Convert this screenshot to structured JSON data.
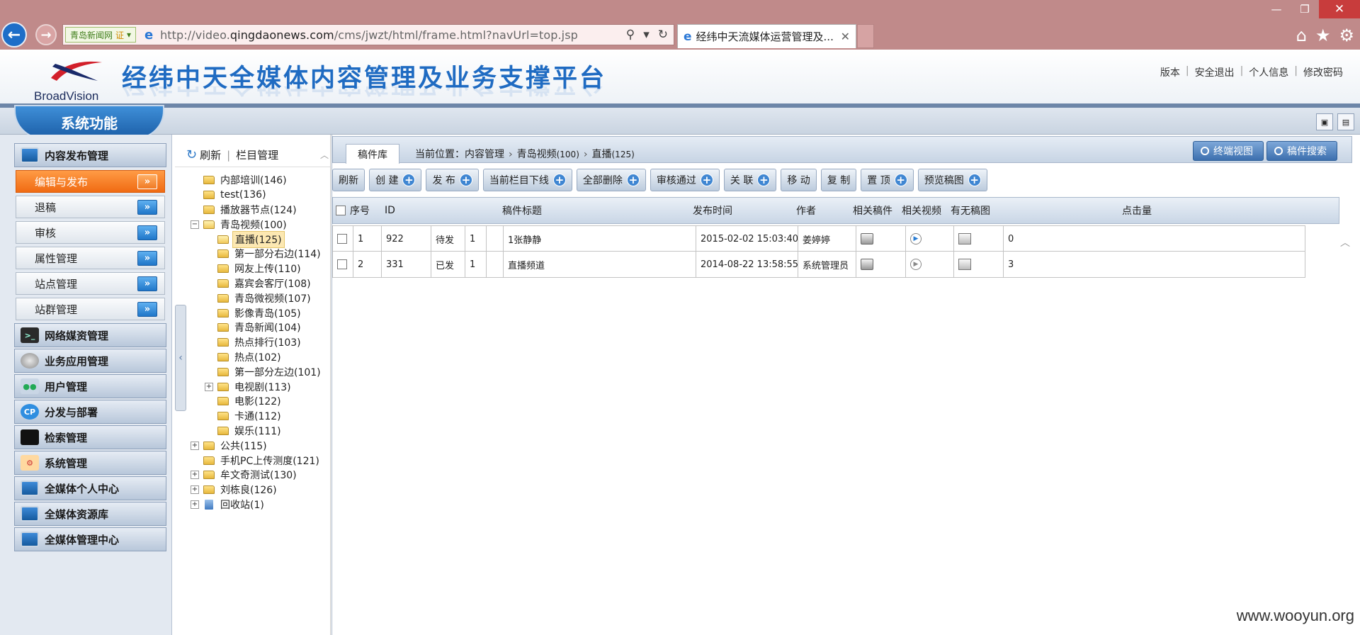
{
  "browser": {
    "site_tag": "青岛新闻网",
    "cert_label": "证",
    "url_prefix": "http://video.",
    "url_domain": "qingdaonews.com",
    "url_path": "/cms/jwzt/html/frame.html?navUrl=top.jsp",
    "tab_title": "经纬中天流媒体运营管理及..."
  },
  "header": {
    "logo_text": "BroadVision",
    "title": "经纬中天全媒体内容管理及业务支撑平台",
    "links": [
      "版本",
      "安全退出",
      "个人信息",
      "修改密码"
    ]
  },
  "function_bar": {
    "label": "系统功能"
  },
  "left_menu": {
    "groups_top": [
      {
        "label": "内容发布管理",
        "icon": "monitor-icon"
      }
    ],
    "sub_items": [
      {
        "label": "编辑与发布",
        "active": true
      },
      {
        "label": "退稿"
      },
      {
        "label": "审核"
      },
      {
        "label": "属性管理"
      },
      {
        "label": "站点管理"
      },
      {
        "label": "站群管理"
      }
    ],
    "groups_bottom": [
      {
        "label": "网络媒资管理",
        "icon": "terminal-icon"
      },
      {
        "label": "业务应用管理",
        "icon": "disk-icon"
      },
      {
        "label": "用户管理",
        "icon": "users-icon"
      },
      {
        "label": "分发与部署",
        "icon": "cp-icon"
      },
      {
        "label": "检索管理",
        "icon": "screen-icon"
      },
      {
        "label": "系统管理",
        "icon": "system-icon"
      },
      {
        "label": "全媒体个人中心",
        "icon": "monitor-icon"
      },
      {
        "label": "全媒体资源库",
        "icon": "monitor-icon"
      },
      {
        "label": "全媒体管理中心",
        "icon": "monitor-icon"
      }
    ]
  },
  "tree": {
    "refresh_label": "刷新",
    "manage_label": "栏目管理",
    "nodes": [
      {
        "label": "内部培训(146)",
        "level": 0,
        "toggle": ""
      },
      {
        "label": "test(136)",
        "level": 0,
        "toggle": ""
      },
      {
        "label": "播放器节点(124)",
        "level": 0,
        "toggle": ""
      },
      {
        "label": "青岛视频(100)",
        "level": 0,
        "toggle": "-",
        "open": true
      },
      {
        "label": "直播(125)",
        "level": 1,
        "toggle": "",
        "selected": true
      },
      {
        "label": "第一部分右边(114)",
        "level": 1,
        "toggle": ""
      },
      {
        "label": "网友上传(110)",
        "level": 1,
        "toggle": ""
      },
      {
        "label": "嘉宾会客厅(108)",
        "level": 1,
        "toggle": ""
      },
      {
        "label": "青岛微视频(107)",
        "level": 1,
        "toggle": ""
      },
      {
        "label": "影像青岛(105)",
        "level": 1,
        "toggle": ""
      },
      {
        "label": "青岛新闻(104)",
        "level": 1,
        "toggle": ""
      },
      {
        "label": "热点排行(103)",
        "level": 1,
        "toggle": ""
      },
      {
        "label": "热点(102)",
        "level": 1,
        "toggle": ""
      },
      {
        "label": "第一部分左边(101)",
        "level": 1,
        "toggle": ""
      },
      {
        "label": "电视剧(113)",
        "level": 1,
        "toggle": "+"
      },
      {
        "label": "电影(122)",
        "level": 1,
        "toggle": ""
      },
      {
        "label": "卡通(112)",
        "level": 1,
        "toggle": ""
      },
      {
        "label": "娱乐(111)",
        "level": 1,
        "toggle": ""
      },
      {
        "label": "公共(115)",
        "level": 0,
        "toggle": "+"
      },
      {
        "label": "手机PC上传测度(121)",
        "level": 0,
        "toggle": ""
      },
      {
        "label": "牟文奇测试(130)",
        "level": 0,
        "toggle": "+"
      },
      {
        "label": "刘栋良(126)",
        "level": 0,
        "toggle": "+"
      },
      {
        "label": "回收站(1)",
        "level": 0,
        "toggle": "+",
        "trash": true
      }
    ]
  },
  "main": {
    "lib_tab": "稿件库",
    "crumb_prefix": "当前位置：",
    "crumb_1": "内容管理",
    "crumb_2": "青岛视频",
    "crumb_2_count": "(100)",
    "crumb_3": "直播",
    "crumb_3_count": "(125)",
    "right_buttons": [
      "终端视图",
      "稿件搜索"
    ],
    "toolbar": [
      {
        "label": "刷新",
        "plus": false
      },
      {
        "label": "创 建",
        "plus": true
      },
      {
        "label": "发 布",
        "plus": true
      },
      {
        "label": "当前栏目下线",
        "plus": true
      },
      {
        "label": "全部删除",
        "plus": true
      },
      {
        "label": "审核通过",
        "plus": true
      },
      {
        "label": "关 联",
        "plus": true
      },
      {
        "label": "移 动",
        "plus": false
      },
      {
        "label": "复 制",
        "plus": false
      },
      {
        "label": "置 顶",
        "plus": true
      },
      {
        "label": "预览稿图",
        "plus": true
      }
    ],
    "columns": [
      "序号",
      "ID",
      "稿件标题",
      "发布时间",
      "作者",
      "相关稿件",
      "相关视频",
      "有无稿图",
      "点击量"
    ],
    "rows": [
      {
        "seq": "1",
        "id": "922",
        "status": "待发",
        "n": "1",
        "title": "1张静静",
        "time": "2015-02-02 15:03:40",
        "author": "姜婷婷",
        "video_active": true,
        "clicks": "0"
      },
      {
        "seq": "2",
        "id": "331",
        "status": "已发",
        "n": "1",
        "title": "直播频道",
        "time": "2014-08-22 13:58:55",
        "author": "系统管理员",
        "video_active": false,
        "clicks": "3"
      }
    ]
  },
  "watermark": "www.wooyun.org"
}
